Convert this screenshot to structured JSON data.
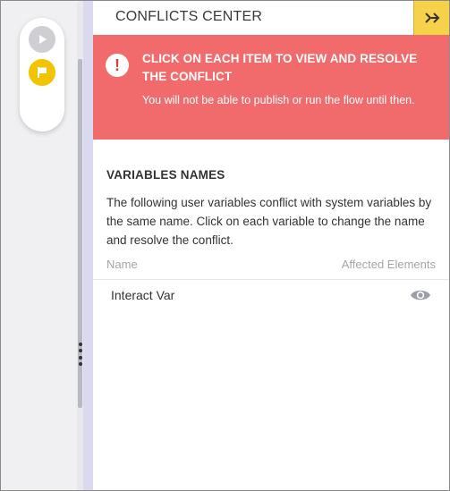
{
  "panel": {
    "title": "CONFLICTS CENTER",
    "close_icon": "double-arrow-right-icon"
  },
  "toolbar": {
    "play_icon": "play-icon",
    "flag_icon": "flag-icon"
  },
  "alert": {
    "icon": "exclamation-icon",
    "title": "CLICK ON EACH ITEM TO VIEW AND RESOLVE THE CONFLICT",
    "message": "You will not be able to publish or run the flow until then."
  },
  "section": {
    "title": "VARIABLES NAMES",
    "description": "The following user variables conflict with system variables by the same name. Click on each variable to change the name and resolve the conflict."
  },
  "table": {
    "columns": [
      "Name",
      "Affected Elements"
    ],
    "rows": [
      {
        "name": "Interact Var",
        "icon": "eye-icon"
      }
    ]
  },
  "colors": {
    "alert_bg": "#f26b6c",
    "close_bg": "#f6d24a",
    "flag_bg": "#f2c400",
    "panel_edge": "#d9d9f0"
  }
}
